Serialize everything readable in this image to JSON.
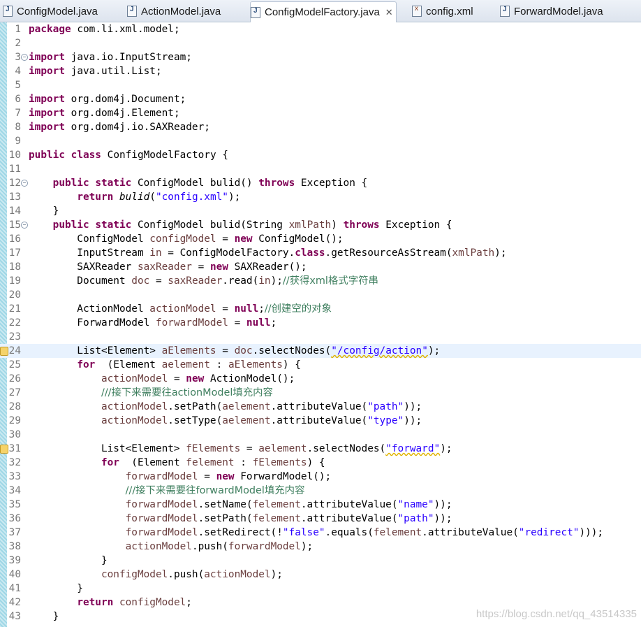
{
  "tabs": [
    {
      "label": "ConfigModel.java",
      "icon": "java-file-icon",
      "active": false
    },
    {
      "label": "ActionModel.java",
      "icon": "java-file-icon",
      "active": false
    },
    {
      "label": "ConfigModelFactory.java",
      "icon": "java-file-icon",
      "active": true
    },
    {
      "label": "config.xml",
      "icon": "xml-file-icon",
      "active": false
    },
    {
      "label": "ForwardModel.java",
      "icon": "java-file-icon",
      "active": false
    }
  ],
  "close_glyph": "✕",
  "current_line": 24,
  "colors": {
    "keyword": "#7f0055",
    "string": "#2a00ff",
    "local": "#6a3e3e",
    "comment": "#3f7f5f",
    "line_highlight": "#e8f2fe",
    "ruler": "#9fd7e6"
  },
  "lines": [
    {
      "n": "1",
      "code": [
        [
          "kw",
          "package"
        ],
        [
          "",
          "com.li.xml.model;"
        ]
      ]
    },
    {
      "n": "2",
      "code": []
    },
    {
      "n": "3",
      "fold": true,
      "code": [
        [
          "kw",
          "import"
        ],
        [
          "",
          "java.io.InputStream;"
        ]
      ]
    },
    {
      "n": "4",
      "code": [
        [
          "kw",
          "import"
        ],
        [
          "",
          "java.util.List;"
        ]
      ]
    },
    {
      "n": "5",
      "code": []
    },
    {
      "n": "6",
      "code": [
        [
          "kw",
          "import"
        ],
        [
          "",
          "org.dom4j.Document;"
        ]
      ]
    },
    {
      "n": "7",
      "code": [
        [
          "kw",
          "import"
        ],
        [
          "",
          "org.dom4j.Element;"
        ]
      ]
    },
    {
      "n": "8",
      "code": [
        [
          "kw",
          "import"
        ],
        [
          "",
          "org.dom4j.io.SAXReader;"
        ]
      ]
    },
    {
      "n": "9",
      "code": []
    },
    {
      "n": "10",
      "code": [
        [
          "kw",
          "public"
        ],
        [
          "kw",
          "class"
        ],
        [
          "",
          "ConfigModelFactory {"
        ]
      ]
    },
    {
      "n": "11",
      "code": []
    },
    {
      "n": "12",
      "fold": true,
      "code": [
        [
          "",
          "    "
        ],
        [
          "kw",
          "public"
        ],
        [
          "kw",
          "static"
        ],
        [
          "",
          "ConfigModel bulid() "
        ],
        [
          "kw",
          "throws"
        ],
        [
          "",
          "Exception {"
        ]
      ]
    },
    {
      "n": "13",
      "code": [
        [
          "",
          "        "
        ],
        [
          "kw",
          "return"
        ],
        [
          "it",
          "bulid"
        ],
        [
          "",
          "("
        ],
        [
          "str",
          "\"config.xml\""
        ],
        [
          "",
          ");"
        ]
      ]
    },
    {
      "n": "14",
      "code": [
        [
          "",
          "    }"
        ]
      ]
    },
    {
      "n": "15",
      "fold": true,
      "code": [
        [
          "",
          "    "
        ],
        [
          "kw",
          "public"
        ],
        [
          "kw",
          "static"
        ],
        [
          "",
          "ConfigModel bulid(String "
        ],
        [
          "fld",
          "xmlPath"
        ],
        [
          "",
          ") "
        ],
        [
          "kw",
          "throws"
        ],
        [
          "",
          "Exception {"
        ]
      ]
    },
    {
      "n": "16",
      "code": [
        [
          "",
          "        ConfigModel "
        ],
        [
          "fld",
          "configModel"
        ],
        [
          "",
          " = "
        ],
        [
          "kw",
          "new"
        ],
        [
          "",
          "ConfigModel();"
        ]
      ]
    },
    {
      "n": "17",
      "code": [
        [
          "",
          "        InputStream "
        ],
        [
          "fld",
          "in"
        ],
        [
          "",
          " = ConfigModelFactory."
        ],
        [
          "kw",
          "class"
        ],
        [
          "",
          ".getResourceAsStream("
        ],
        [
          "fld",
          "xmlPath"
        ],
        [
          "",
          ");"
        ]
      ]
    },
    {
      "n": "18",
      "code": [
        [
          "",
          "        SAXReader "
        ],
        [
          "fld",
          "saxReader"
        ],
        [
          "",
          " = "
        ],
        [
          "kw",
          "new"
        ],
        [
          "",
          "SAXReader();"
        ]
      ]
    },
    {
      "n": "19",
      "code": [
        [
          "",
          "        Document "
        ],
        [
          "fld",
          "doc"
        ],
        [
          "",
          " = "
        ],
        [
          "fld",
          "saxReader"
        ],
        [
          "",
          ".read("
        ],
        [
          "fld",
          "in"
        ],
        [
          "",
          ");"
        ],
        [
          "com",
          "//获得xml格式字符串"
        ]
      ]
    },
    {
      "n": "20",
      "code": []
    },
    {
      "n": "21",
      "code": [
        [
          "",
          "        ActionModel "
        ],
        [
          "fld",
          "actionModel"
        ],
        [
          "",
          " = "
        ],
        [
          "kw",
          "null"
        ],
        [
          "",
          ";"
        ],
        [
          "com",
          "//创建空的对象"
        ]
      ]
    },
    {
      "n": "22",
      "code": [
        [
          "",
          "        ForwardModel "
        ],
        [
          "fld",
          "forwardModel"
        ],
        [
          "",
          " = "
        ],
        [
          "kw",
          "null"
        ],
        [
          "",
          ";"
        ]
      ]
    },
    {
      "n": "23",
      "code": []
    },
    {
      "n": "24",
      "warn": true,
      "code": [
        [
          "",
          "        List<Element> "
        ],
        [
          "fld",
          "aElements"
        ],
        [
          "",
          " = "
        ],
        [
          "fld",
          "doc"
        ],
        [
          "",
          ".selectNodes("
        ],
        [
          "strs",
          "\"/config/action\""
        ],
        [
          "",
          ");"
        ]
      ]
    },
    {
      "n": "25",
      "code": [
        [
          "",
          "        "
        ],
        [
          "kw",
          "for"
        ],
        [
          "",
          " (Element "
        ],
        [
          "fld",
          "aelement"
        ],
        [
          "",
          " : "
        ],
        [
          "fld",
          "aElements"
        ],
        [
          "",
          ") {"
        ]
      ]
    },
    {
      "n": "26",
      "code": [
        [
          "",
          "            "
        ],
        [
          "fld",
          "actionModel"
        ],
        [
          "",
          " = "
        ],
        [
          "kw",
          "new"
        ],
        [
          "",
          "ActionModel();"
        ]
      ]
    },
    {
      "n": "27",
      "code": [
        [
          "",
          "            "
        ],
        [
          "com",
          "///接下来需要往actionModel填充内容"
        ]
      ]
    },
    {
      "n": "28",
      "code": [
        [
          "",
          "            "
        ],
        [
          "fld",
          "actionModel"
        ],
        [
          "",
          ".setPath("
        ],
        [
          "fld",
          "aelement"
        ],
        [
          "",
          ".attributeValue("
        ],
        [
          "str",
          "\"path\""
        ],
        [
          "",
          "));"
        ]
      ]
    },
    {
      "n": "29",
      "code": [
        [
          "",
          "            "
        ],
        [
          "fld",
          "actionModel"
        ],
        [
          "",
          ".setType("
        ],
        [
          "fld",
          "aelement"
        ],
        [
          "",
          ".attributeValue("
        ],
        [
          "str",
          "\"type\""
        ],
        [
          "",
          "));"
        ]
      ]
    },
    {
      "n": "30",
      "code": []
    },
    {
      "n": "31",
      "warn": true,
      "code": [
        [
          "",
          "            List<Element> "
        ],
        [
          "fld",
          "fElements"
        ],
        [
          "",
          " = "
        ],
        [
          "fld",
          "aelement"
        ],
        [
          "",
          ".selectNodes("
        ],
        [
          "strs",
          "\"forward\""
        ],
        [
          "",
          ");"
        ]
      ]
    },
    {
      "n": "32",
      "code": [
        [
          "",
          "            "
        ],
        [
          "kw",
          "for"
        ],
        [
          "",
          " (Element "
        ],
        [
          "fld",
          "felement"
        ],
        [
          "",
          " : "
        ],
        [
          "fld",
          "fElements"
        ],
        [
          "",
          ") {"
        ]
      ]
    },
    {
      "n": "33",
      "code": [
        [
          "",
          "                "
        ],
        [
          "fld",
          "forwardModel"
        ],
        [
          "",
          " = "
        ],
        [
          "kw",
          "new"
        ],
        [
          "",
          "ForwardModel();"
        ]
      ]
    },
    {
      "n": "34",
      "code": [
        [
          "",
          "                "
        ],
        [
          "com",
          "///接下来需要往forwardModel填充内容"
        ]
      ]
    },
    {
      "n": "35",
      "code": [
        [
          "",
          "                "
        ],
        [
          "fld",
          "forwardModel"
        ],
        [
          "",
          ".setName("
        ],
        [
          "fld",
          "felement"
        ],
        [
          "",
          ".attributeValue("
        ],
        [
          "str",
          "\"name\""
        ],
        [
          "",
          "));"
        ]
      ]
    },
    {
      "n": "36",
      "code": [
        [
          "",
          "                "
        ],
        [
          "fld",
          "forwardModel"
        ],
        [
          "",
          ".setPath("
        ],
        [
          "fld",
          "felement"
        ],
        [
          "",
          ".attributeValue("
        ],
        [
          "str",
          "\"path\""
        ],
        [
          "",
          "));"
        ]
      ]
    },
    {
      "n": "37",
      "code": [
        [
          "",
          "                "
        ],
        [
          "fld",
          "forwardModel"
        ],
        [
          "",
          ".setRedirect(!"
        ],
        [
          "str",
          "\"false\""
        ],
        [
          "",
          ".equals("
        ],
        [
          "fld",
          "felement"
        ],
        [
          "",
          ".attributeValue("
        ],
        [
          "str",
          "\"redirect\""
        ],
        [
          "",
          ")));"
        ]
      ]
    },
    {
      "n": "38",
      "code": [
        [
          "",
          "                "
        ],
        [
          "fld",
          "actionModel"
        ],
        [
          "",
          ".push("
        ],
        [
          "fld",
          "forwardModel"
        ],
        [
          "",
          ");"
        ]
      ]
    },
    {
      "n": "39",
      "code": [
        [
          "",
          "            }"
        ]
      ]
    },
    {
      "n": "40",
      "code": [
        [
          "",
          "            "
        ],
        [
          "fld",
          "configModel"
        ],
        [
          "",
          ".push("
        ],
        [
          "fld",
          "actionModel"
        ],
        [
          "",
          ");"
        ]
      ]
    },
    {
      "n": "41",
      "code": [
        [
          "",
          "        }"
        ]
      ]
    },
    {
      "n": "42",
      "code": [
        [
          "",
          "        "
        ],
        [
          "kw",
          "return"
        ],
        [
          "fld",
          "configModel"
        ],
        [
          "",
          ";"
        ]
      ]
    },
    {
      "n": "43",
      "code": [
        [
          "",
          "    }"
        ]
      ]
    }
  ],
  "watermark": "https://blog.csdn.net/qq_43514335"
}
